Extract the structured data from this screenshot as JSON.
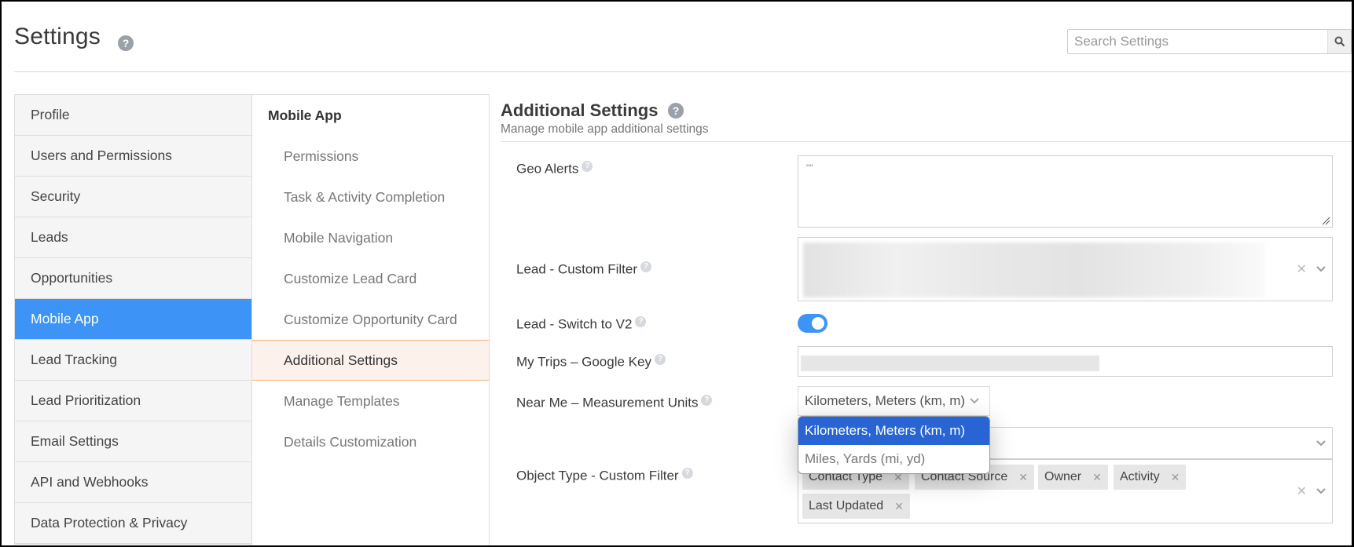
{
  "header": {
    "title": "Settings",
    "help_icon": "question-circle-icon",
    "search": {
      "placeholder": "Search Settings",
      "value": "",
      "icon": "search-icon"
    }
  },
  "sidebar": {
    "items": [
      {
        "label": "Profile",
        "active": false
      },
      {
        "label": "Users and Permissions",
        "active": false
      },
      {
        "label": "Security",
        "active": false
      },
      {
        "label": "Leads",
        "active": false
      },
      {
        "label": "Opportunities",
        "active": false
      },
      {
        "label": "Mobile App",
        "active": true
      },
      {
        "label": "Lead Tracking",
        "active": false
      },
      {
        "label": "Lead Prioritization",
        "active": false
      },
      {
        "label": "Email Settings",
        "active": false
      },
      {
        "label": "API and Webhooks",
        "active": false
      },
      {
        "label": "Data Protection & Privacy",
        "active": false
      }
    ]
  },
  "submenu": {
    "header": "Mobile App",
    "items": [
      {
        "label": "Permissions",
        "active": false
      },
      {
        "label": "Task & Activity Completion",
        "active": false
      },
      {
        "label": "Mobile Navigation",
        "active": false
      },
      {
        "label": "Customize Lead Card",
        "active": false
      },
      {
        "label": "Customize Opportunity Card",
        "active": false
      },
      {
        "label": "Additional Settings",
        "active": true
      },
      {
        "label": "Manage Templates",
        "active": false
      },
      {
        "label": "Details Customization",
        "active": false
      }
    ]
  },
  "main": {
    "title": "Additional Settings",
    "subtitle": "Manage mobile app additional settings",
    "fields": {
      "geo_alerts": {
        "label": "Geo Alerts",
        "value": "\"\""
      },
      "lead_custom_filter": {
        "label": "Lead - Custom Filter",
        "value": "[redacted]"
      },
      "lead_switch_v2": {
        "label": "Lead - Switch to V2",
        "enabled": true
      },
      "google_key": {
        "label": "My Trips – Google Key",
        "value": "[redacted]"
      },
      "measurement_units": {
        "label": "Near Me – Measurement Units",
        "selected": "Kilometers, Meters (km, m)",
        "options": [
          "Kilometers, Meters (km, m)",
          "Miles, Yards (mi, yd)"
        ],
        "dropdown_open": true
      },
      "object_type_filter": {
        "label": "Object Type - Custom Filter",
        "tags": [
          "Contact Type",
          "Contact Source",
          "Owner",
          "Activity",
          "Last Updated"
        ]
      }
    }
  },
  "colors": {
    "accent_blue": "#3d94f6",
    "dropdown_selected": "#2864d4",
    "submenu_active_bg": "#fdf1ec",
    "submenu_active_border": "#f5b27a"
  }
}
